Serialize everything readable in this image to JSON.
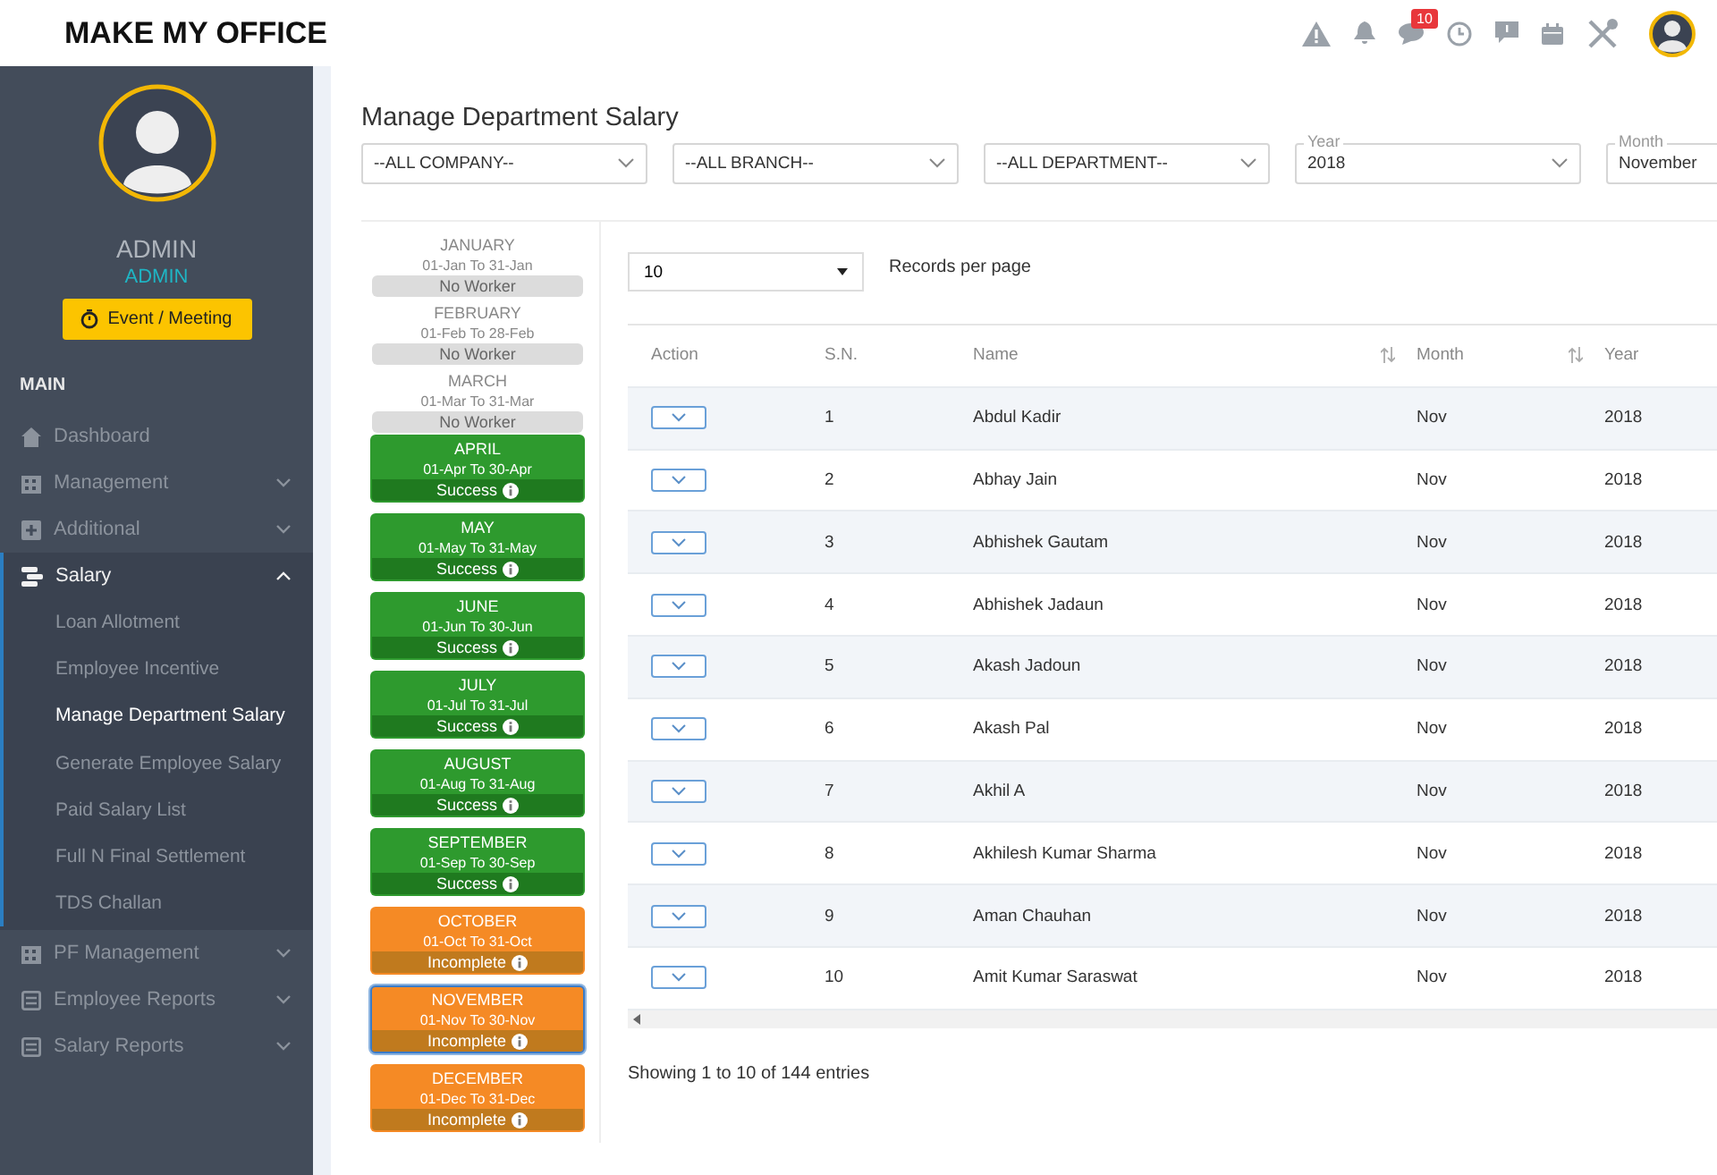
{
  "header": {
    "logo": "MAKE MY OFFICE",
    "notification_badge": "10"
  },
  "sidebar": {
    "user_name": "ADMIN",
    "user_role": "ADMIN",
    "event_button": "Event / Meeting",
    "section": "MAIN",
    "items": [
      {
        "label": "Dashboard",
        "kind": "home",
        "has_caret": false,
        "expanded": false
      },
      {
        "label": "Management",
        "kind": "building",
        "has_caret": true,
        "expanded": false
      },
      {
        "label": "Additional",
        "kind": "plus",
        "has_caret": true,
        "expanded": false
      },
      {
        "label": "Salary",
        "kind": "money",
        "has_caret": true,
        "expanded": true,
        "children": [
          {
            "label": "Loan Allotment",
            "selected": false
          },
          {
            "label": "Employee Incentive",
            "selected": false
          },
          {
            "label": "Manage Department Salary",
            "selected": true
          },
          {
            "label": "Generate Employee Salary",
            "selected": false
          },
          {
            "label": "Paid Salary List",
            "selected": false
          },
          {
            "label": "Full N Final Settlement",
            "selected": false
          },
          {
            "label": "TDS Challan",
            "selected": false
          }
        ]
      },
      {
        "label": "PF Management",
        "kind": "building",
        "has_caret": true,
        "expanded": false
      },
      {
        "label": "Employee Reports",
        "kind": "report",
        "has_caret": true,
        "expanded": false
      },
      {
        "label": "Salary Reports",
        "kind": "report",
        "has_caret": true,
        "expanded": false
      }
    ]
  },
  "page_title": "Manage Department Salary",
  "filters": [
    {
      "value": "--ALL COMPANY--"
    },
    {
      "value": "--ALL BRANCH--"
    },
    {
      "value": "--ALL DEPARTMENT--"
    },
    {
      "label": "Year",
      "value": "2018"
    },
    {
      "label": "Month",
      "value": "November"
    }
  ],
  "months": [
    {
      "name": "JANUARY",
      "range": "01-Jan To 31-Jan",
      "status": "No Worker",
      "kind": "none",
      "selected": false
    },
    {
      "name": "FEBRUARY",
      "range": "01-Feb To 28-Feb",
      "status": "No Worker",
      "kind": "none",
      "selected": false
    },
    {
      "name": "MARCH",
      "range": "01-Mar To 31-Mar",
      "status": "No Worker",
      "kind": "none",
      "selected": false
    },
    {
      "name": "APRIL",
      "range": "01-Apr To 30-Apr",
      "status": "Success",
      "kind": "success",
      "selected": false
    },
    {
      "name": "MAY",
      "range": "01-May To 31-May",
      "status": "Success",
      "kind": "success",
      "selected": false
    },
    {
      "name": "JUNE",
      "range": "01-Jun To 30-Jun",
      "status": "Success",
      "kind": "success",
      "selected": false
    },
    {
      "name": "JULY",
      "range": "01-Jul To 31-Jul",
      "status": "Success",
      "kind": "success",
      "selected": false
    },
    {
      "name": "AUGUST",
      "range": "01-Aug To 31-Aug",
      "status": "Success",
      "kind": "success",
      "selected": false
    },
    {
      "name": "SEPTEMBER",
      "range": "01-Sep To 30-Sep",
      "status": "Success",
      "kind": "success",
      "selected": false
    },
    {
      "name": "OCTOBER",
      "range": "01-Oct To 31-Oct",
      "status": "Incomplete",
      "kind": "incomplete",
      "selected": false
    },
    {
      "name": "NOVEMBER",
      "range": "01-Nov To 30-Nov",
      "status": "Incomplete",
      "kind": "incomplete",
      "selected": true
    },
    {
      "name": "DECEMBER",
      "range": "01-Dec To 31-Dec",
      "status": "Incomplete",
      "kind": "incomplete",
      "selected": false
    }
  ],
  "page_size": "10",
  "page_size_label": "Records per page",
  "table": {
    "columns": [
      {
        "label": "Action",
        "sortable": false
      },
      {
        "label": "S.N.",
        "sortable": false
      },
      {
        "label": "Name",
        "sortable": true
      },
      {
        "label": "Month",
        "sortable": true
      },
      {
        "label": "Year",
        "sortable": false
      }
    ],
    "rows": [
      [
        "",
        "1",
        "Abdul Kadir",
        "Nov",
        "2018"
      ],
      [
        "",
        "2",
        "Abhay Jain",
        "Nov",
        "2018"
      ],
      [
        "",
        "3",
        "Abhishek Gautam",
        "Nov",
        "2018"
      ],
      [
        "",
        "4",
        "Abhishek Jadaun",
        "Nov",
        "2018"
      ],
      [
        "",
        "5",
        "Akash Jadoun",
        "Nov",
        "2018"
      ],
      [
        "",
        "6",
        "Akash Pal",
        "Nov",
        "2018"
      ],
      [
        "",
        "7",
        "Akhil A",
        "Nov",
        "2018"
      ],
      [
        "",
        "8",
        "Akhilesh Kumar Sharma",
        "Nov",
        "2018"
      ],
      [
        "",
        "9",
        "Aman Chauhan",
        "Nov",
        "2018"
      ],
      [
        "",
        "10",
        "Amit Kumar Saraswat",
        "Nov",
        "2018"
      ]
    ]
  },
  "footer_info": "Showing 1 to 10 of 144 entries"
}
